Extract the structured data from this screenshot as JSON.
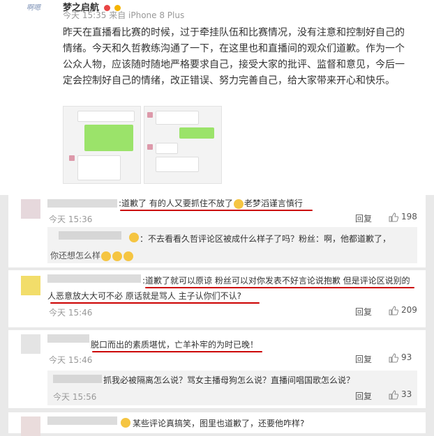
{
  "post": {
    "avatar_text": "啊嗯",
    "username": "梦之启航",
    "meta": "今天 15:35 来自 iPhone 8 Plus",
    "body": "昨天在直播看比赛的时候，过于牵挂队伍和比赛情况，没有注意和控制好自己的情绪。今天和久哲教练沟通了一下，在这里也和直播间的观众们道歉。作为一个公众人物，应该随时随地严格要求自己，接受大家的批评、监督和意见，今后一定会控制好自己的情绪，改正错误、努力完善自己，给大家带来开心和快乐。"
  },
  "comments": [
    {
      "text": ":道歉了 有的人又要抓住不放了",
      "text_tail": "老梦滔谨言慎行",
      "time": "今天 15:36",
      "reply_label": "回复",
      "likes": "198",
      "reply": {
        "text": "：不去看看久哲评论区被成什么样子了吗？粉丝：啊，他都道歉了，",
        "text2": "你还想怎么样"
      }
    },
    {
      "line1": ":道歉了就可以原谅 粉丝可以对你发表不好言论说抱歉 但是评论区说别的",
      "line2": "人恶意放大大可不必 原话就是骂人 主子认你们不认?",
      "time": "今天 15:46",
      "reply_label": "回复",
      "likes": "209"
    },
    {
      "text": "脱口而出的素质堪忧，亡羊补牢的为时已晚！",
      "time": "今天 15:46",
      "reply_label": "回复",
      "likes": "93",
      "reply": {
        "text": "抓我必被隔离怎么说？骂女主播母狗怎么说？直播间唱国歌怎么说？",
        "time": "今天 15:56",
        "reply_label": "回复",
        "likes": "33"
      }
    },
    {
      "text": "某些评论真搞笑，图里也道歉了，还要他咋样?"
    }
  ],
  "colors": {
    "underline": "#cc0000",
    "like_icon": "#888888",
    "badge_red": "#e94545",
    "badge_yellow": "#f5b400"
  }
}
